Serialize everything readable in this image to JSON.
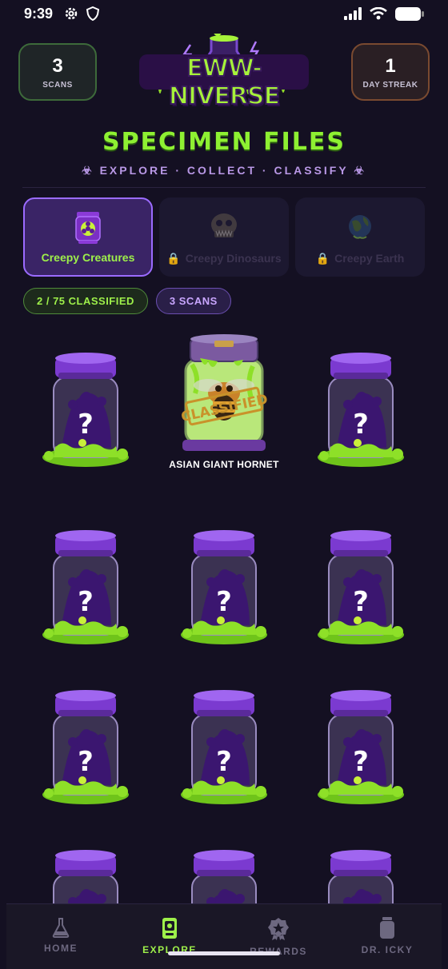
{
  "status": {
    "time": "9:39"
  },
  "header": {
    "scans": {
      "value": "3",
      "label": "SCANS"
    },
    "streak": {
      "value": "1",
      "label": "DAY STREAK"
    },
    "logo_text": "EWW-NIVERSE"
  },
  "page": {
    "title": "SPECIMEN FILES",
    "subtitle": "☣ EXPLORE · COLLECT · CLASSIFY ☣"
  },
  "tabs": [
    {
      "label": "Creepy Creatures",
      "icon": "biohazard-jar-icon",
      "active": true,
      "locked": false
    },
    {
      "label": "Creepy Dinosaurs",
      "icon": "dino-skull-icon",
      "active": false,
      "locked": true
    },
    {
      "label": "Creepy Earth",
      "icon": "earth-icon",
      "active": false,
      "locked": true
    }
  ],
  "pills": {
    "classified": "2 / 75 CLASSIFIED",
    "scans": "3 SCANS"
  },
  "specimens": [
    {
      "name": "",
      "classified": false
    },
    {
      "name": "ASIAN GIANT HORNET",
      "classified": true,
      "stamp": "CLASSIFIED"
    },
    {
      "name": "",
      "classified": false
    },
    {
      "name": "",
      "classified": false
    },
    {
      "name": "",
      "classified": false
    },
    {
      "name": "",
      "classified": false
    },
    {
      "name": "",
      "classified": false
    },
    {
      "name": "",
      "classified": false
    },
    {
      "name": "",
      "classified": false
    },
    {
      "name": "",
      "classified": false
    },
    {
      "name": "",
      "classified": false
    },
    {
      "name": "",
      "classified": false
    }
  ],
  "nav": [
    {
      "label": "HOME",
      "icon": "flask-icon",
      "active": false
    },
    {
      "label": "EXPLORE",
      "icon": "scanner-icon",
      "active": true
    },
    {
      "label": "REWARDS",
      "icon": "badge-icon",
      "active": false
    },
    {
      "label": "DR. ICKY",
      "icon": "jar-icon",
      "active": false
    }
  ],
  "colors": {
    "accent_green": "#9ef04a",
    "accent_purple": "#9b6bff",
    "background": "#141022"
  }
}
